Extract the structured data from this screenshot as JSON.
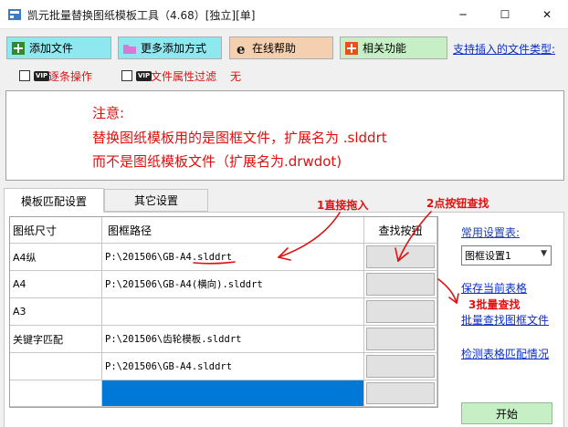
{
  "window": {
    "title": "凯元批量替换图纸模板工具（4.68）[独立][单]",
    "minimize_glyph": "─",
    "maximize_glyph": "☐",
    "close_glyph": "✕"
  },
  "toolbar": {
    "add_files": "添加文件",
    "more_add": "更多添加方式",
    "online_help": "在线帮助",
    "related": "相关功能",
    "file_types_link": "支持插入的文件类型:"
  },
  "options": {
    "vip_badge": "VIP",
    "one_by_one": "逐条操作",
    "attr_filter": "文件属性过滤",
    "attr_filter_value": "无"
  },
  "notice": {
    "line1": "注意:",
    "line2": "替换图纸模板用的是图框文件，扩展名为 .slddrt",
    "line3": "而不是图纸模板文件（扩展名为.drwdot)"
  },
  "tabs": {
    "match": "模板匹配设置",
    "other": "其它设置"
  },
  "grid": {
    "headers": {
      "size": "图纸尺寸",
      "path": "图框路径",
      "find": "查找按钮"
    },
    "rows": [
      {
        "size": "A4纵",
        "path": "P:\\201506\\GB-A4.slddrt"
      },
      {
        "size": "A4",
        "path": "P:\\201506\\GB-A4(横向).slddrt"
      },
      {
        "size": "A3",
        "path": ""
      },
      {
        "size": "关键字匹配",
        "path": "P:\\201506\\齿轮模板.slddrt"
      },
      {
        "size": "",
        "path": "P:\\201506\\GB-A4.slddrt"
      },
      {
        "size": "",
        "path": ""
      }
    ]
  },
  "right_panel": {
    "common_settings": "常用设置表:",
    "preset_value": "图框设置1",
    "save_table": "保存当前表格",
    "batch_find": "批量查找图框文件",
    "detect_match": "检测表格匹配情况",
    "start": "开始"
  },
  "annotations": {
    "step1": "1直接拖入",
    "step2": "2点按钮查找",
    "step3": "3批量查找"
  },
  "colors": {
    "add_files_bg": "#8fe8f0",
    "more_add_bg": "#8fe8f0",
    "online_help_bg": "#f5d0b0",
    "related_bg": "#c6efc6",
    "start_bg": "#c6efc6",
    "annotation_red": "#e01010",
    "selected_cell": "#0078d7"
  }
}
